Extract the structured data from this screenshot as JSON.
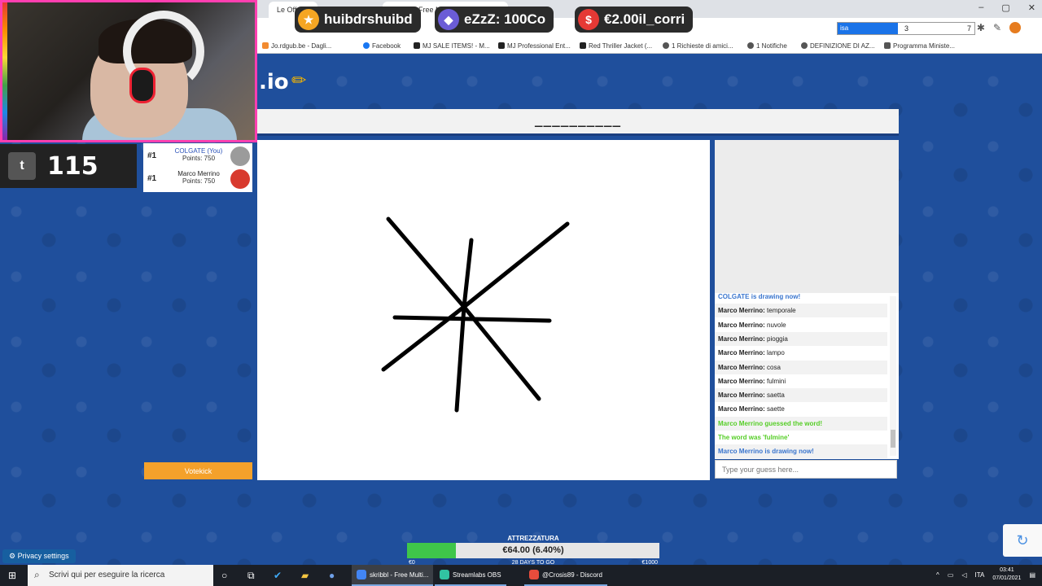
{
  "browser": {
    "tabs": [
      "Le Offerte",
      "skribbl - Free Multiplayer Drawing"
    ],
    "window_controls": [
      "–",
      "▢",
      "✕"
    ],
    "extension_bar": {
      "fill_label": "isa",
      "mid": "3",
      "end": "7"
    },
    "bookmarks": [
      {
        "label": "Jo.rdgub.be - Dagli...",
        "color": "#f28b30"
      },
      {
        "label": "Facebook",
        "color": "#1877f2"
      },
      {
        "label": "MJ SALE ITEMS! - M...",
        "color": "#222222"
      },
      {
        "label": "MJ Professional Ent...",
        "color": "#222222"
      },
      {
        "label": "Red Thriller Jacket (...",
        "color": "#222222"
      },
      {
        "label": "1 Richieste di amici...",
        "color": "#555555"
      },
      {
        "label": "1 Notifiche",
        "color": "#555555"
      },
      {
        "label": "DEFINIZIONE DI AZ...",
        "color": "#555555"
      },
      {
        "label": "Programma Ministe...",
        "color": "#555555"
      }
    ]
  },
  "alerts": [
    {
      "icon": "★",
      "text": "huibdrshuibd",
      "color": "#f5a623"
    },
    {
      "icon": "◆",
      "text": "eZzZ: 100Co",
      "color": "#6b5cd6"
    },
    {
      "icon": "$",
      "text": "€2.00il_corri",
      "color": "#e53935"
    }
  ],
  "stream": {
    "viewer_count": "115",
    "platform_glyph": "t"
  },
  "game": {
    "logo": ".io",
    "word_hint": "__________",
    "players": [
      {
        "rank": "#1",
        "name": "COLGATE (You)",
        "points": "Points: 750",
        "name_color": "#2850b8",
        "avatar": "#9b9b9b"
      },
      {
        "rank": "#1",
        "name": "Marco Merrino",
        "points": "Points: 750",
        "name_color": "#222222",
        "avatar": "#d83a2e"
      }
    ],
    "votekick_label": "Votekick",
    "chat": [
      {
        "user": "",
        "msg": "COLGATE is drawing now!",
        "style": "blue"
      },
      {
        "user": "Marco Merrino:",
        "msg": "temporale",
        "style": "normal"
      },
      {
        "user": "Marco Merrino:",
        "msg": "nuvole",
        "style": "normal"
      },
      {
        "user": "Marco Merrino:",
        "msg": "pioggia",
        "style": "normal"
      },
      {
        "user": "Marco Merrino:",
        "msg": "lampo",
        "style": "normal"
      },
      {
        "user": "Marco Merrino:",
        "msg": "cosa",
        "style": "normal"
      },
      {
        "user": "Marco Merrino:",
        "msg": "fulmini",
        "style": "normal"
      },
      {
        "user": "Marco Merrino:",
        "msg": "saetta",
        "style": "normal"
      },
      {
        "user": "Marco Merrino:",
        "msg": "saette",
        "style": "normal"
      },
      {
        "user": "",
        "msg": "Marco Merrino guessed the word!",
        "style": "green"
      },
      {
        "user": "",
        "msg": "The word was 'fulmine'",
        "style": "green"
      },
      {
        "user": "",
        "msg": "Marco Merrino is drawing now!",
        "style": "blue"
      }
    ],
    "guess_placeholder": "Type your guess here..."
  },
  "goal": {
    "title": "ATTREZZATURA",
    "amount_text": "€64.00 (6.40%)",
    "progress_fraction": 0.064,
    "start": "€0",
    "days_left": "28 DAYS TO GO",
    "end": "€1000"
  },
  "privacy_label": "Privacy settings",
  "taskbar": {
    "search_placeholder": "Scrivi qui per eseguire la ricerca",
    "apps": [
      {
        "label": "skribbl - Free Multi...",
        "color": "#4285f4",
        "active": true
      },
      {
        "label": "Streamlabs OBS",
        "color": "#31c3a2",
        "active": false
      },
      {
        "label": "@Crosis89 - Discord",
        "color": "#e74c3c",
        "active": false
      }
    ],
    "lang": "ITA",
    "time": "03:41",
    "date": "07/01/2021"
  }
}
